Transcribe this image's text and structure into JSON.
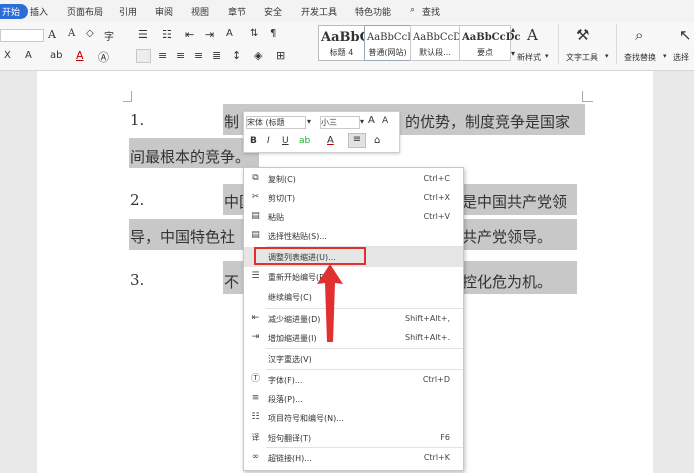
{
  "menubar": {
    "start": "开始",
    "items": [
      "插入",
      "页面布局",
      "引用",
      "审阅",
      "视图",
      "章节",
      "安全",
      "开发工具",
      "特色功能"
    ],
    "search": "查找"
  },
  "ribbon": {
    "styles": [
      {
        "preview": "AaBbC",
        "name": "标题 4"
      },
      {
        "preview": "AaBbCcD",
        "name": "普通(网站)"
      },
      {
        "preview": "AaBbCcDd",
        "name": "默认段..."
      },
      {
        "preview": "AaBbCcDc",
        "name": "要点"
      }
    ],
    "new_style": "新样式",
    "text_tools": "文字工具",
    "find_replace": "查找替换",
    "select": "选择"
  },
  "mini_toolbar": {
    "font": "宋体 (标题",
    "size": "小三"
  },
  "document": {
    "p1_num": "1.",
    "p1_a": "制",
    "p1_b": "的优势，制度竞争是国家",
    "p1_cont": "间最根本的竞争。",
    "p2_num": "2.",
    "p2_a": "中国",
    "p2_b": "是中国共产党领",
    "p2_cont_a": "导，中国特色社",
    "p2_cont_b": "共产党领导。",
    "p3_num": "3.",
    "p3_a": "不",
    "p3_b": "防控化危为机。"
  },
  "context_menu": [
    {
      "icon": "copy-icon",
      "glyph": "⧉",
      "label": "复制(C)",
      "shortcut": "Ctrl+C"
    },
    {
      "icon": "cut-icon",
      "glyph": "✂",
      "label": "剪切(T)",
      "shortcut": "Ctrl+X"
    },
    {
      "icon": "paste-icon",
      "glyph": "📋",
      "label": "粘贴",
      "shortcut": "Ctrl+V"
    },
    {
      "icon": "paste-special-icon",
      "glyph": "📋",
      "label": "选择性粘贴(S)...",
      "shortcut": ""
    },
    {
      "icon": "",
      "glyph": "",
      "label": "调整列表缩进(U)...",
      "shortcut": ""
    },
    {
      "icon": "restart-numbering-icon",
      "glyph": "☰",
      "label": "重新开始编号(R)",
      "shortcut": ""
    },
    {
      "icon": "",
      "glyph": "",
      "label": "继续编号(C)",
      "shortcut": ""
    },
    {
      "icon": "decrease-indent-icon",
      "glyph": "⇤",
      "label": "减少缩进量(D)",
      "shortcut": "Shift+Alt+,"
    },
    {
      "icon": "increase-indent-icon",
      "glyph": "⇥",
      "label": "增加缩进量(I)",
      "shortcut": "Shift+Alt+."
    },
    {
      "icon": "",
      "glyph": "",
      "label": "汉字重选(V)",
      "shortcut": ""
    },
    {
      "icon": "font-icon",
      "glyph": "Ⓣ",
      "label": "字体(F)...",
      "shortcut": "Ctrl+D"
    },
    {
      "icon": "paragraph-icon",
      "glyph": "≡",
      "label": "段落(P)...",
      "shortcut": ""
    },
    {
      "icon": "bullets-numbering-icon",
      "glyph": "☷",
      "label": "项目符号和编号(N)...",
      "shortcut": ""
    },
    {
      "icon": "translate-icon",
      "glyph": "译",
      "label": "短句翻译(T)",
      "shortcut": "F6"
    },
    {
      "icon": "hyperlink-icon",
      "glyph": "🔗",
      "label": "超链接(H)...",
      "shortcut": "Ctrl+K"
    }
  ]
}
